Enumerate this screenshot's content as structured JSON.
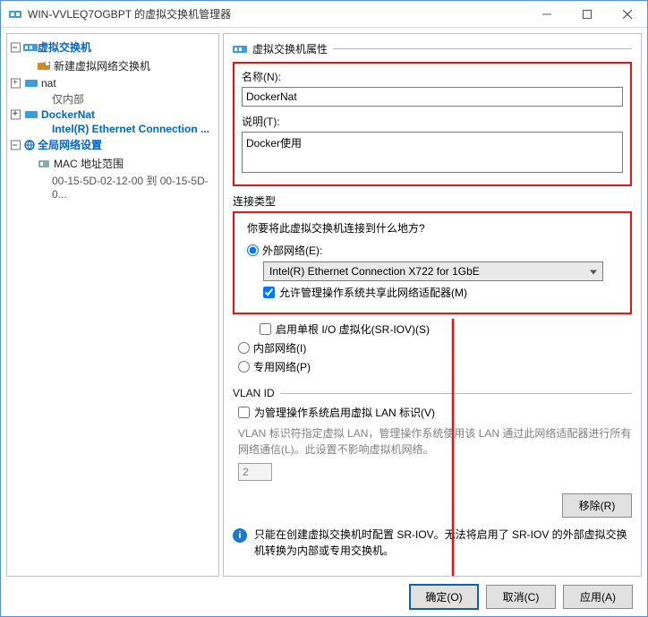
{
  "titlebar": {
    "title": "WIN-VVLEQ7OGBPT 的虚拟交换机管理器"
  },
  "tree": {
    "header1": "虚拟交换机",
    "new_switch": "新建虚拟网络交换机",
    "nat": "nat",
    "nat_sub": "仅内部",
    "dockernat": "DockerNat",
    "dockernat_sub": "Intel(R) Ethernet Connection ...",
    "header2": "全局网络设置",
    "mac_range": "MAC 地址范围",
    "mac_sub": "00-15-5D-02-12-00 到 00-15-5D-0..."
  },
  "right": {
    "panel_title": "虚拟交换机属性",
    "name_label": "名称(N):",
    "name_value": "DockerNat",
    "desc_label": "说明(T):",
    "desc_value": "Docker使用",
    "conn_title": "连接类型",
    "conn_question": "你要将此虚拟交换机连接到什么地方?",
    "radio_external": "外部网络(E):",
    "combo_value": "Intel(R) Ethernet Connection X722 for 1GbE",
    "chk_share": "允许管理操作系统共享此网络适配器(M)",
    "chk_sriov": "启用单根 I/O 虚拟化(SR-IOV)(S)",
    "radio_internal": "内部网络(I)",
    "radio_private": "专用网络(P)",
    "vlan_title": "VLAN ID",
    "chk_vlan": "为管理操作系统启用虚拟 LAN 标识(V)",
    "vlan_hint": "VLAN 标识符指定虚拟 LAN，管理操作系统使用该 LAN 通过此网络适配器进行所有网络通信(L)。此设置不影响虚拟机网络。",
    "vlan_value": "2",
    "btn_remove": "移除(R)",
    "info_text": "只能在创建虚拟交换机时配置 SR-IOV。无法将启用了 SR-IOV 的外部虚拟交换机转换为内部或专用交换机。"
  },
  "footer": {
    "ok": "确定(O)",
    "cancel": "取消(C)",
    "apply": "应用(A)"
  }
}
